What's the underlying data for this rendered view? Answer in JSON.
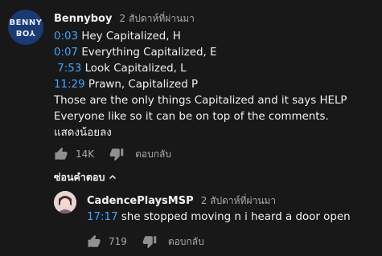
{
  "comment": {
    "avatar_text_top": "BENNY",
    "avatar_text_bottom": "BOY",
    "author": "Bennyboy",
    "time": "2 สัปดาห์ที่ผ่านมา",
    "lines": [
      {
        "timestamp": "0:03",
        "text": " Hey Capitalized, H"
      },
      {
        "timestamp": "0:07",
        "text": " Everything Capitalized, E"
      },
      {
        "timestamp": " 7:53",
        "text": " Look Capitalized, L"
      },
      {
        "timestamp": "11:29",
        "text": " Prawn, Capitalized P"
      },
      {
        "timestamp": "",
        "text": "Those are the only things Capitalized and it says HELP"
      },
      {
        "timestamp": "",
        "text": "Everyone like so it can be on top of the comments."
      }
    ],
    "show_less": "แสดงน้อยลง",
    "likes": "14K",
    "reply_label": "ตอบกลับ"
  },
  "hide_replies_label": "ซ่อนคำตอบ",
  "reply": {
    "author": "CadencePlaysMSP",
    "time": "2 สัปดาห์ที่ผ่านมา",
    "timestamp": "17:17",
    "text": " she stopped moving n i heard a door open",
    "likes": "719",
    "reply_label": "ตอบกลับ"
  },
  "colors": {
    "background": "#181818",
    "timestamp_link": "#3ea6ff",
    "secondary_text": "#aaaaaa",
    "primary_text": "#f1f1f1"
  },
  "icons": {
    "like": "thumbs-up-icon",
    "dislike": "thumbs-down-icon",
    "collapse": "chevron-up-icon"
  }
}
